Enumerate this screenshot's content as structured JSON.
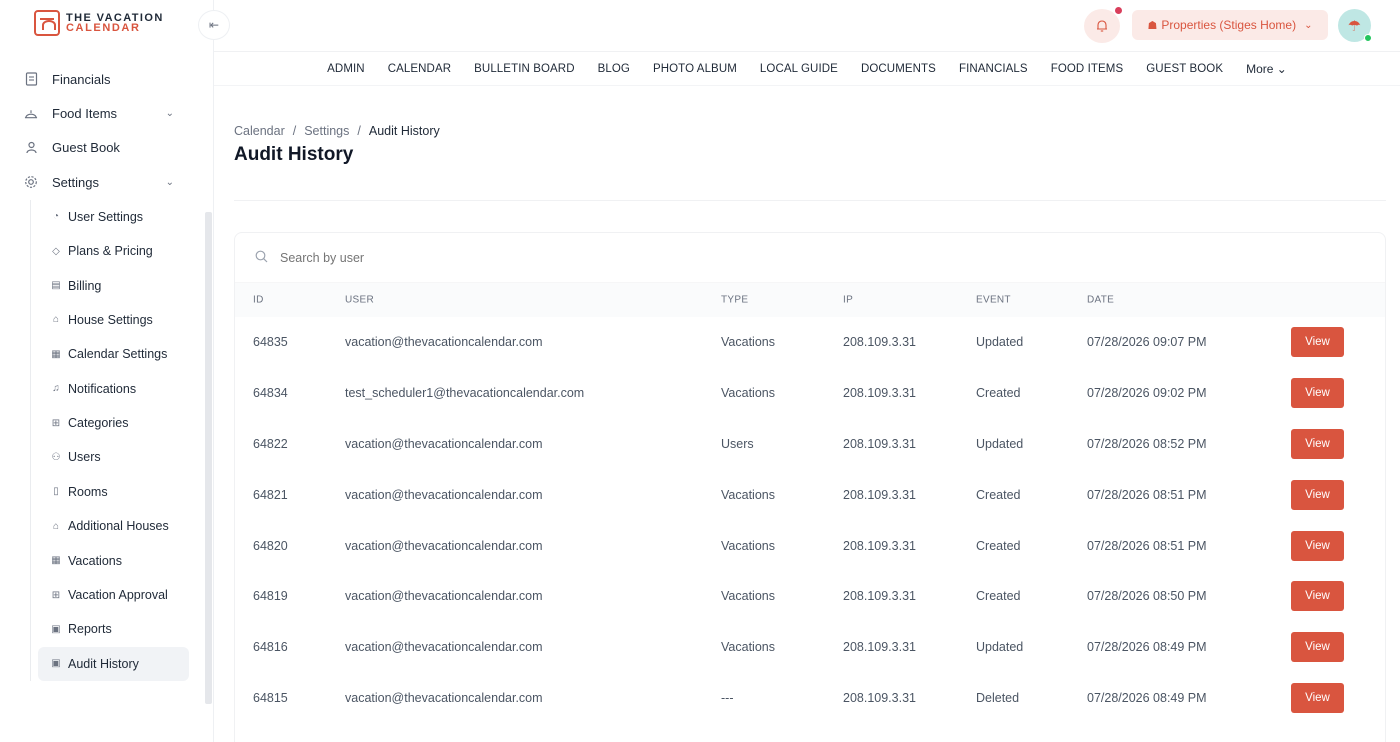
{
  "brand": {
    "top": "THE VACATION",
    "bottom": "CALENDAR"
  },
  "sidebar": {
    "items": [
      {
        "label": "Financials",
        "icon": "receipt-icon"
      },
      {
        "label": "Food Items",
        "icon": "food-icon",
        "expandable": true
      },
      {
        "label": "Guest Book",
        "icon": "guestbook-icon"
      },
      {
        "label": "Settings",
        "icon": "gear-icon",
        "expandable": true
      }
    ],
    "settings_children": [
      {
        "label": "User Settings",
        "icon": "user-icon"
      },
      {
        "label": "Plans & Pricing",
        "icon": "tag-icon"
      },
      {
        "label": "Billing",
        "icon": "invoice-icon"
      },
      {
        "label": "House Settings",
        "icon": "house-icon"
      },
      {
        "label": "Calendar Settings",
        "icon": "calendar-icon"
      },
      {
        "label": "Notifications",
        "icon": "bell-icon"
      },
      {
        "label": "Categories",
        "icon": "grid-icon"
      },
      {
        "label": "Users",
        "icon": "users-icon"
      },
      {
        "label": "Rooms",
        "icon": "door-icon"
      },
      {
        "label": "Additional Houses",
        "icon": "house-icon"
      },
      {
        "label": "Vacations",
        "icon": "calendar-icon"
      },
      {
        "label": "Vacation Approval",
        "icon": "grid-icon"
      },
      {
        "label": "Reports",
        "icon": "report-icon"
      },
      {
        "label": "Audit History",
        "icon": "report-icon",
        "active": true
      }
    ]
  },
  "header": {
    "property_label": "Properties (Stiges Home)",
    "accent": "#d9553f"
  },
  "menu": [
    "ADMIN",
    "CALENDAR",
    "BULLETIN BOARD",
    "BLOG",
    "PHOTO ALBUM",
    "LOCAL GUIDE",
    "DOCUMENTS",
    "FINANCIALS",
    "FOOD ITEMS",
    "GUEST BOOK"
  ],
  "menu_more": "More",
  "breadcrumb": [
    "Calendar",
    "Settings",
    "Audit History"
  ],
  "page_title": "Audit History",
  "search": {
    "placeholder": "Search by user"
  },
  "table": {
    "columns": [
      "ID",
      "USER",
      "TYPE",
      "IP",
      "EVENT",
      "DATE"
    ],
    "action_label": "View",
    "rows": [
      {
        "id": "64835",
        "user": "vacation@thevacationcalendar.com",
        "type": "Vacations",
        "ip": "208.109.3.31",
        "event": "Updated",
        "date": "07/28/2026 09:07 PM"
      },
      {
        "id": "64834",
        "user": "test_scheduler1@thevacationcalendar.com",
        "type": "Vacations",
        "ip": "208.109.3.31",
        "event": "Created",
        "date": "07/28/2026 09:02 PM"
      },
      {
        "id": "64822",
        "user": "vacation@thevacationcalendar.com",
        "type": "Users",
        "ip": "208.109.3.31",
        "event": "Updated",
        "date": "07/28/2026 08:52 PM"
      },
      {
        "id": "64821",
        "user": "vacation@thevacationcalendar.com",
        "type": "Vacations",
        "ip": "208.109.3.31",
        "event": "Created",
        "date": "07/28/2026 08:51 PM"
      },
      {
        "id": "64820",
        "user": "vacation@thevacationcalendar.com",
        "type": "Vacations",
        "ip": "208.109.3.31",
        "event": "Created",
        "date": "07/28/2026 08:51 PM"
      },
      {
        "id": "64819",
        "user": "vacation@thevacationcalendar.com",
        "type": "Vacations",
        "ip": "208.109.3.31",
        "event": "Created",
        "date": "07/28/2026 08:50 PM"
      },
      {
        "id": "64816",
        "user": "vacation@thevacationcalendar.com",
        "type": "Vacations",
        "ip": "208.109.3.31",
        "event": "Updated",
        "date": "07/28/2026 08:49 PM"
      },
      {
        "id": "64815",
        "user": "vacation@thevacationcalendar.com",
        "type": "---",
        "ip": "208.109.3.31",
        "event": "Deleted",
        "date": "07/28/2026 08:49 PM"
      }
    ]
  }
}
